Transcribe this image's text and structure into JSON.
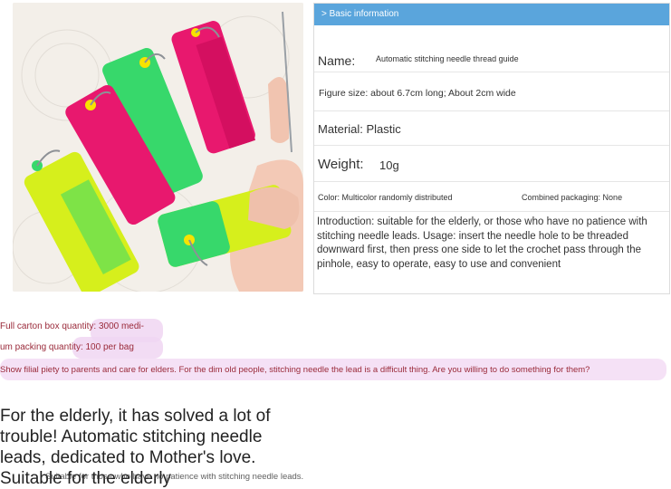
{
  "info": {
    "header": "> Basic information",
    "name_label": "Name:",
    "name_value": "Automatic stitching needle thread guide",
    "figure_size": "Figure size: about 6.7cm long; About 2cm wide",
    "material": "Material: Plastic",
    "weight_label": "Weight:",
    "weight_value": "10g",
    "color": "Color: Multicolor randomly distributed",
    "packaging": "Combined packaging: None",
    "introduction": "Introduction: suitable for the elderly, or those who have no patience with stitching needle leads. Usage: insert the needle hole to be threaded downward first, then press one side to let the crochet pass through the pinhole, easy to operate, easy to use and convenient"
  },
  "notes": {
    "carton_line1": "Full carton box quantity: 3000 medi-",
    "carton_line2": "um packing quantity: 100 per bag",
    "filial": "Show filial piety to parents and care for elders. For the dim old people, stitching needle the lead is a difficult thing. Are you willing to do something for them?"
  },
  "promo": {
    "headline": "For the elderly, it has solved a lot of trouble! Automatic stitching needle leads, dedicated to Mother's love. Suitable for the elderly",
    "overlap_line": "Suitable for those who have no patience with stitching needle leads."
  },
  "colors": {
    "header_blue": "#5aa5dc",
    "threader_pink": "#e8186e",
    "threader_green": "#37d86b",
    "threader_yellow": "#d6ef1c"
  }
}
